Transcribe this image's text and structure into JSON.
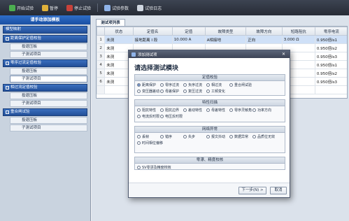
{
  "toolbar": {
    "items": [
      {
        "label": "开始试验",
        "icon": "play-icon",
        "color": "#4caf50"
      },
      {
        "label": "暂停",
        "icon": "pause-icon",
        "color": "#e0b13a"
      },
      {
        "label": "停止试验",
        "icon": "stop-icon",
        "color": "#c9423a"
      },
      {
        "label": "试验参数",
        "icon": "params-icon",
        "color": "#8fb3e8"
      },
      {
        "label": "试验日志",
        "icon": "log-icon",
        "color": "#cfd6e0"
      }
    ]
  },
  "sidebar": {
    "title": "请手动添加模板",
    "groups": [
      {
        "label": "模型映射",
        "toggle": "",
        "items": []
      },
      {
        "label": "距离保护定值校验",
        "toggle": "−",
        "items": [
          "投退压板",
          "子测试项目"
        ]
      },
      {
        "label": "零序过流定值校验",
        "toggle": "−",
        "items": [
          "投退压板",
          "子测试项目"
        ]
      },
      {
        "label": "相过流定值校验",
        "toggle": "−",
        "items": [
          "投退压板",
          "子测试项目"
        ]
      },
      {
        "label": "重合闸试验",
        "toggle": "−",
        "items": [
          "投退压板",
          "子测试项目"
        ]
      }
    ],
    "active_item": "子测试项目"
  },
  "main": {
    "tab_label": "测试项列表",
    "columns": [
      "",
      "状态",
      "定值名",
      "定值",
      "故障类型",
      "故障方向",
      "短路阻抗",
      "零序电流"
    ],
    "rows": [
      [
        "1",
        "未测",
        "接地距离 I 段",
        "10.000 A",
        "A相接地",
        "正向",
        "3.000 Ω",
        "0.950倍Is1"
      ],
      [
        "2",
        "未测",
        "",
        "",
        "",
        "",
        "",
        "0.950倍Is2"
      ],
      [
        "3",
        "未测",
        "",
        "",
        "",
        "",
        "",
        "0.950倍Is3"
      ],
      [
        "4",
        "未测",
        "",
        "",
        "",
        "",
        "",
        "0.950倍Is1"
      ],
      [
        "5",
        "未测",
        "",
        "",
        "",
        "",
        "",
        "0.950倍Is2"
      ],
      [
        "6",
        "未测",
        "",
        "",
        "",
        "",
        "",
        "0.950倍Is3"
      ],
      [
        "",
        "",
        "",
        "",
        "",
        "",
        "",
        ""
      ]
    ]
  },
  "modal": {
    "title": "添加测试项",
    "heading": "请选择测试模块",
    "sections": [
      {
        "title": "定值校验",
        "options": [
          {
            "label": "距离保护",
            "selected": true,
            "wide": false
          },
          {
            "label": "零序过流",
            "selected": false,
            "wide": false
          },
          {
            "label": "负序过流",
            "selected": false,
            "wide": false
          },
          {
            "label": "相过流",
            "selected": false,
            "wide": false
          },
          {
            "label": "重合闸试验",
            "selected": false,
            "wide": true
          },
          {
            "label": "变压器差动",
            "selected": false,
            "wide": false
          },
          {
            "label": "母差保护",
            "selected": false,
            "wide": false
          },
          {
            "label": "复压过流",
            "selected": false,
            "wide": false
          },
          {
            "label": "工频变化",
            "selected": false,
            "wide": false
          }
        ]
      },
      {
        "title": "特性扫描",
        "options": [
          {
            "label": "阻抗特性",
            "selected": false,
            "wide": false
          },
          {
            "label": "阻抗边界",
            "selected": false,
            "wide": false
          },
          {
            "label": "差动特性",
            "selected": false,
            "wide": false
          },
          {
            "label": "母差特性",
            "selected": false,
            "wide": false
          },
          {
            "label": "零序灵敏角",
            "selected": false,
            "wide": false
          },
          {
            "label": "功率方向",
            "selected": false,
            "wide": false
          },
          {
            "label": "电流反时限",
            "selected": false,
            "wide": false
          },
          {
            "label": "电压反时限",
            "selected": false,
            "wide": false
          }
        ]
      },
      {
        "title": "网络异常",
        "options": [
          {
            "label": "丢帧",
            "selected": false,
            "wide": false
          },
          {
            "label": "错序",
            "selected": false,
            "wide": false
          },
          {
            "label": "失步",
            "selected": false,
            "wide": false
          },
          {
            "label": "报文抖动",
            "selected": false,
            "wide": false
          },
          {
            "label": "数据异常",
            "selected": false,
            "wide": false
          },
          {
            "label": "品质位无效",
            "selected": false,
            "wide": false
          },
          {
            "label": "时间相位偏移",
            "selected": false,
            "wide": true
          }
        ]
      },
      {
        "title": "零漂、精度校核",
        "options": [
          {
            "label": "SV零漂及精度校核",
            "selected": false,
            "wide": true
          }
        ]
      }
    ],
    "next_label": "下一步(N) >",
    "cancel_label": "取消"
  }
}
